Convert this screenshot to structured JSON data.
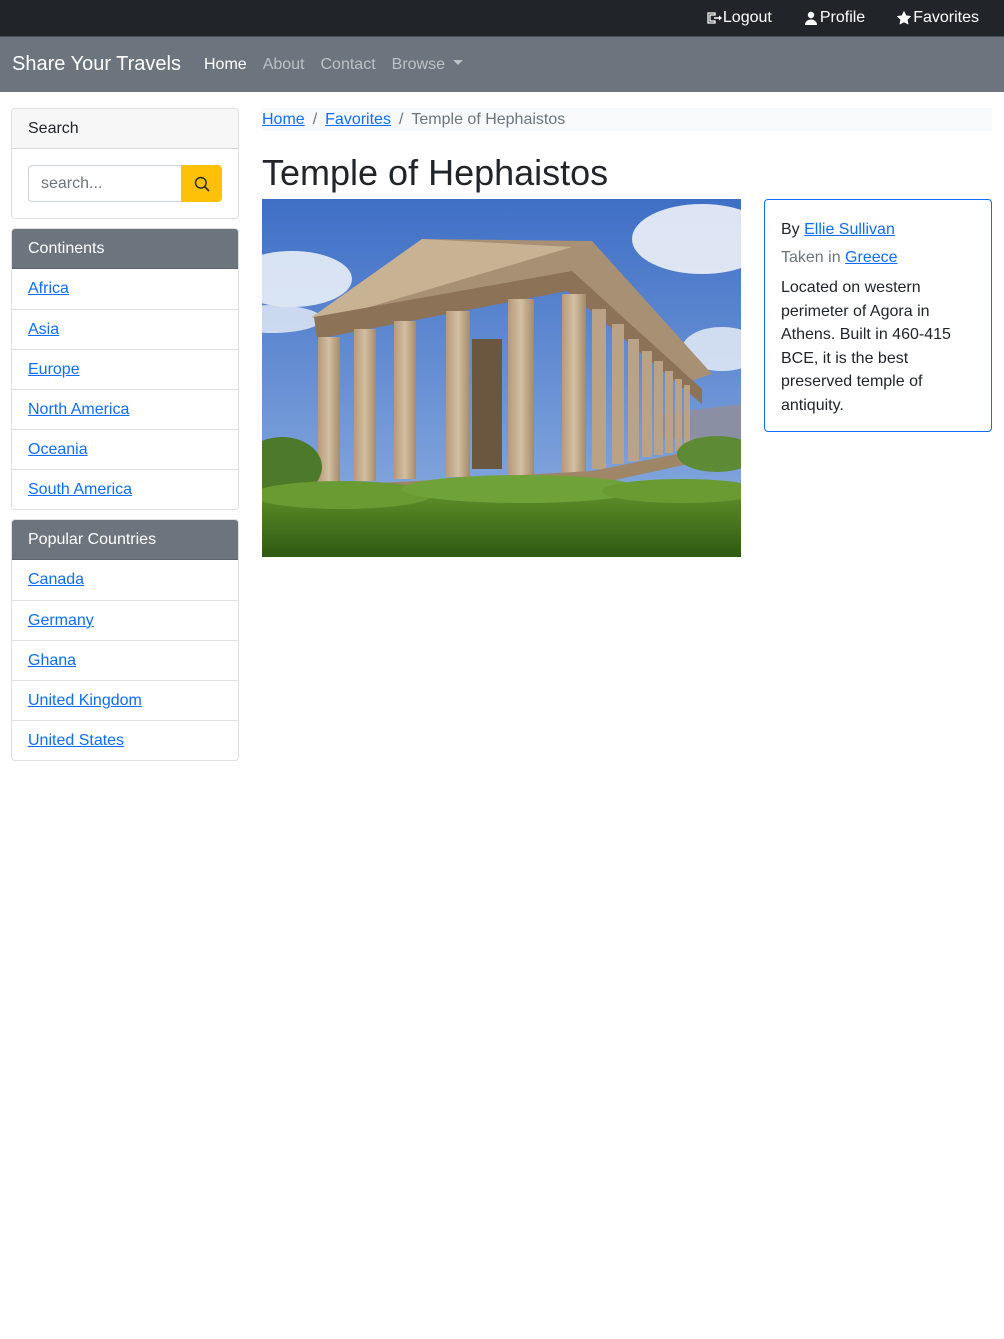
{
  "topbar": {
    "logout": "Logout",
    "profile": "Profile",
    "favorites": "Favorites"
  },
  "navbar": {
    "brand": "Share Your Travels",
    "links": [
      "Home",
      "About",
      "Contact",
      "Browse"
    ]
  },
  "search": {
    "title": "Search",
    "placeholder": "search..."
  },
  "continents": {
    "title": "Continents",
    "items": [
      "Africa",
      "Asia",
      "Europe",
      "North America",
      "Oceania",
      "South America"
    ]
  },
  "countries": {
    "title": "Popular Countries",
    "items": [
      "Canada",
      "Germany",
      "Ghana",
      "United Kingdom",
      "United States"
    ]
  },
  "breadcrumb": {
    "home": "Home",
    "favorites": "Favorites",
    "current": "Temple of Hephaistos"
  },
  "photo": {
    "title": "Temple of Hephaistos",
    "by_label": "By",
    "author": "Ellie Sullivan",
    "taken_label": "Taken in",
    "country": "Greece",
    "description": "Located on western perimeter of Agora in Athens. Built in 460-415 BCE, it is the best preserved temple of antiquity."
  },
  "colors": {
    "topbar": "#212529",
    "navbar": "#6c757d",
    "search_button": "#ffc107",
    "link": "#0d6efd"
  }
}
